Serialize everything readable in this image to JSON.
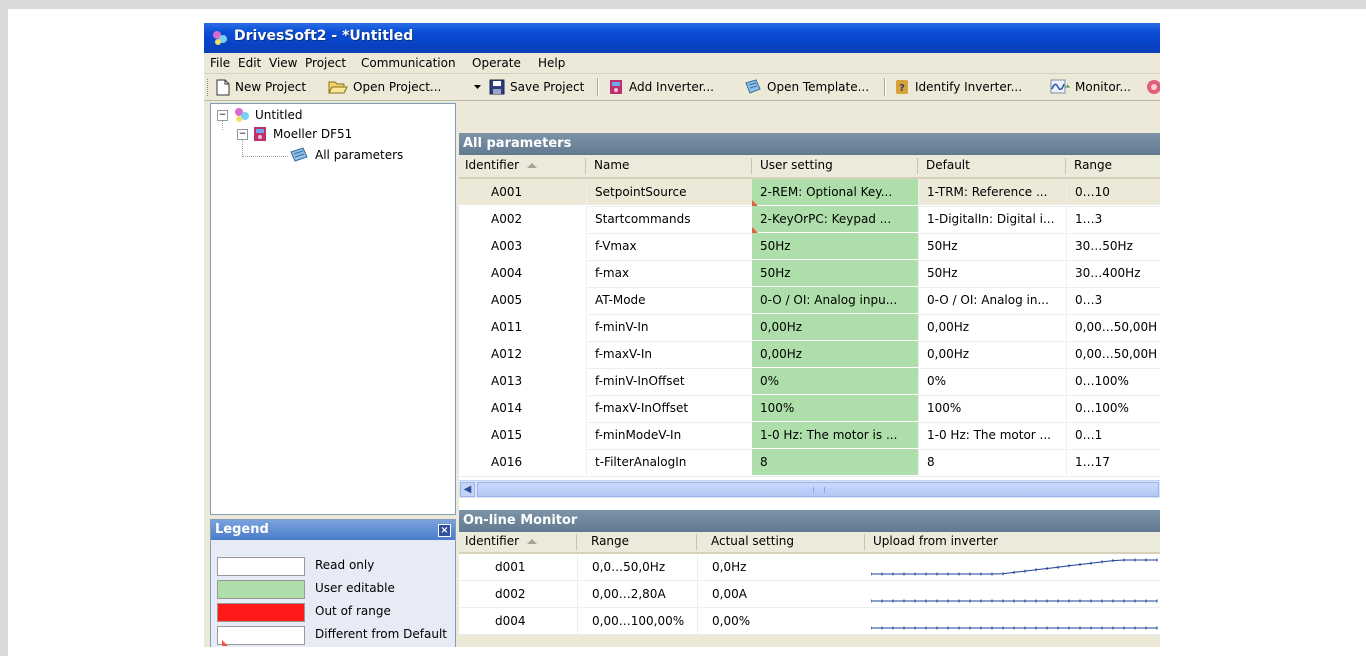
{
  "window": {
    "title": "DrivesSoft2 - *Untitled"
  },
  "menu": [
    "File",
    "Edit",
    "View",
    "Project",
    "Communication",
    "Operate",
    "Help"
  ],
  "toolbar": {
    "new_project": "New Project",
    "open_project": "Open Project...",
    "save_project": "Save Project",
    "add_inverter": "Add Inverter...",
    "open_template": "Open Template...",
    "identify_inverter": "Identify Inverter...",
    "monitor": "Monitor..."
  },
  "tree": {
    "root": "Untitled",
    "device": "Moeller DF51",
    "leaf": "All parameters"
  },
  "legend": {
    "title": "Legend",
    "items": [
      {
        "label": "Read only",
        "color": "#ffffff"
      },
      {
        "label": "User editable",
        "color": "#aedfaa"
      },
      {
        "label": "Out of range",
        "color": "#ff1a1a"
      },
      {
        "label": "Different from Default",
        "color": "#ffffff"
      }
    ]
  },
  "params": {
    "title": "All parameters",
    "columns": [
      "Identifier",
      "Name",
      "User setting",
      "Default",
      "Range"
    ],
    "rows": [
      {
        "id": "A001",
        "name": "SetpointSource",
        "user": "2-REM: Optional Key...",
        "default": "1-TRM: Reference ...",
        "range": "0…10"
      },
      {
        "id": "A002",
        "name": "Startcommands",
        "user": "2-KeyOrPC: Keypad ...",
        "default": "1-DigitalIn: Digital i...",
        "range": "1…3"
      },
      {
        "id": "A003",
        "name": "f-Vmax",
        "user": "50Hz",
        "default": "50Hz",
        "range": "30…50Hz"
      },
      {
        "id": "A004",
        "name": "f-max",
        "user": "50Hz",
        "default": "50Hz",
        "range": "30…400Hz"
      },
      {
        "id": "A005",
        "name": "AT-Mode",
        "user": "0-O / OI: Analog inpu...",
        "default": "0-O / OI: Analog in...",
        "range": "0…3"
      },
      {
        "id": "A011",
        "name": "f-minV-In",
        "user": "0,00Hz",
        "default": "0,00Hz",
        "range": "0,00…50,00H"
      },
      {
        "id": "A012",
        "name": "f-maxV-In",
        "user": "0,00Hz",
        "default": "0,00Hz",
        "range": "0,00…50,00H"
      },
      {
        "id": "A013",
        "name": "f-minV-InOffset",
        "user": "0%",
        "default": "0%",
        "range": "0…100%"
      },
      {
        "id": "A014",
        "name": "f-maxV-InOffset",
        "user": "100%",
        "default": "100%",
        "range": "0…100%"
      },
      {
        "id": "A015",
        "name": "f-minModeV-In",
        "user": "1-0 Hz: The motor is ...",
        "default": "1-0 Hz: The motor ...",
        "range": "0…1"
      },
      {
        "id": "A016",
        "name": "t-FilterAnalogIn",
        "user": "8",
        "default": "8",
        "range": "1…17"
      }
    ]
  },
  "monitor": {
    "title": "On-line Monitor",
    "columns": [
      "Identifier",
      "Range",
      "Actual setting",
      "Upload from inverter"
    ],
    "rows": [
      {
        "id": "d001",
        "range": "0,0…50,0Hz",
        "actual": "0,0Hz"
      },
      {
        "id": "d002",
        "range": "0,00…2,80A",
        "actual": "0,00A"
      },
      {
        "id": "d004",
        "range": "0,00…100,00%",
        "actual": "0,00%"
      }
    ]
  },
  "colors": {
    "titlebar": "#0a4fd8",
    "user_editable": "#aedfaa",
    "panel_header": "#6f879c",
    "out_of_range": "#ff1a1a"
  }
}
